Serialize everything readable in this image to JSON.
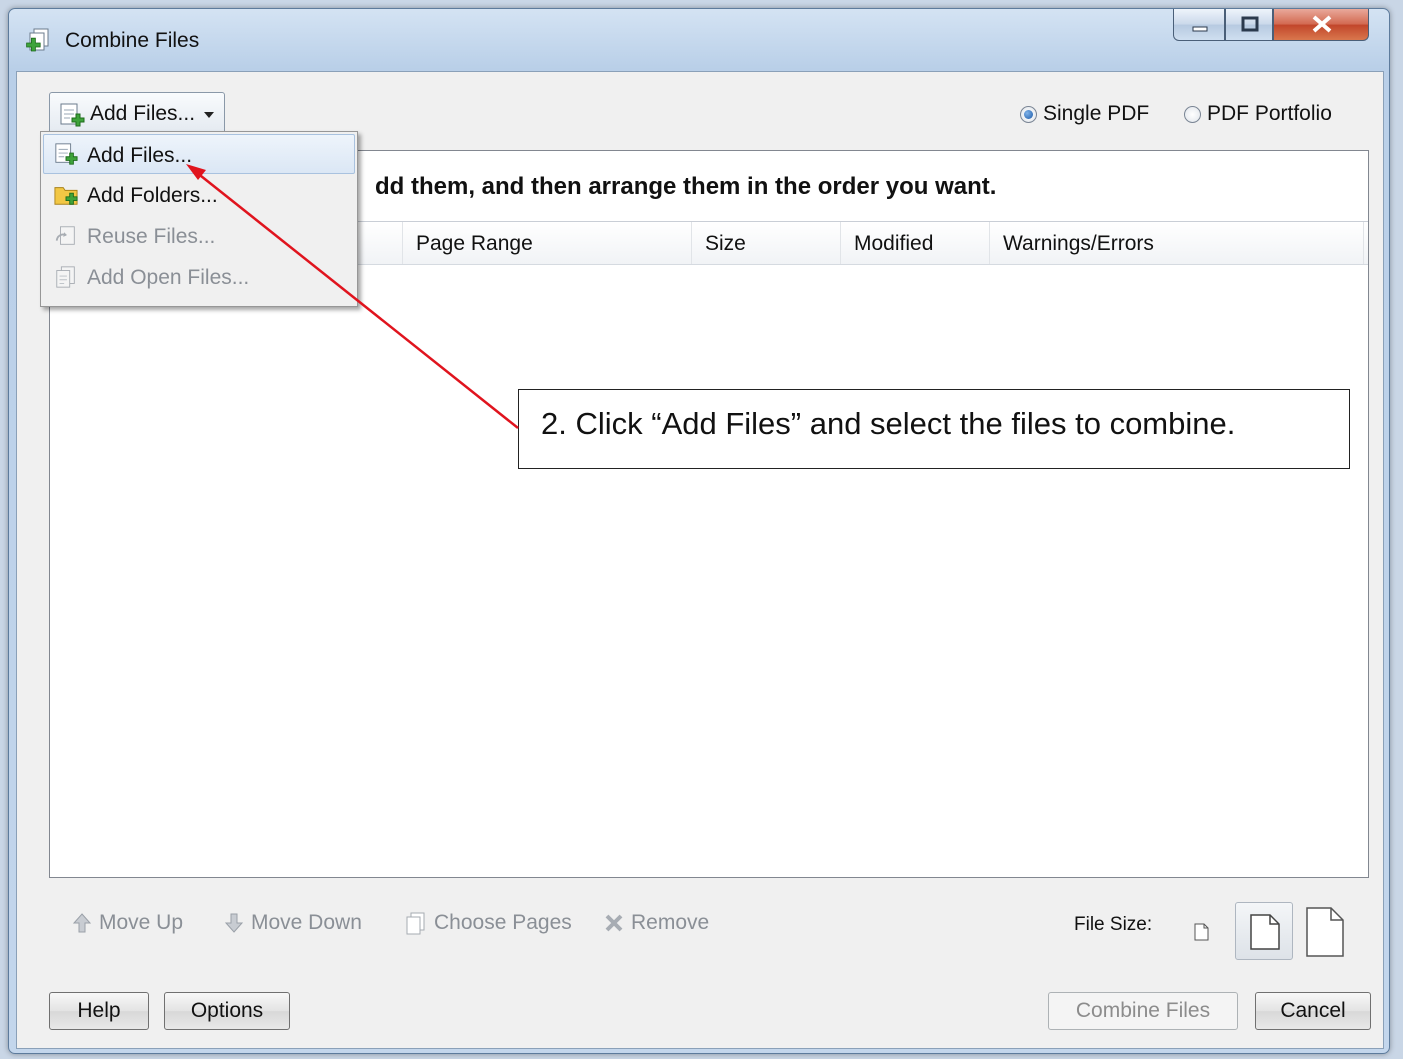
{
  "window": {
    "title": "Combine Files"
  },
  "toolbar": {
    "add_files_label": "Add Files...",
    "output_options": [
      {
        "label": "Single PDF",
        "selected": true
      },
      {
        "label": "PDF Portfolio",
        "selected": false
      }
    ]
  },
  "list": {
    "instruction": "dd them, and then arrange them in the order you want.",
    "columns": [
      "Page Range",
      "Size",
      "Modified",
      "Warnings/Errors"
    ]
  },
  "dropdown_menu": {
    "items": [
      {
        "label": "Add Files...",
        "enabled": true,
        "highlighted": true,
        "icon": "add-file-icon"
      },
      {
        "label": "Add Folders...",
        "enabled": true,
        "highlighted": false,
        "icon": "add-folder-icon"
      },
      {
        "label": "Reuse Files...",
        "enabled": false,
        "highlighted": false,
        "icon": "reuse-files-icon"
      },
      {
        "label": "Add Open Files...",
        "enabled": false,
        "highlighted": false,
        "icon": "add-open-files-icon"
      }
    ]
  },
  "bottom_toolbar": {
    "move_up": "Move Up",
    "move_down": "Move Down",
    "choose_pages": "Choose Pages",
    "remove": "Remove",
    "file_size_label": "File Size:"
  },
  "footer": {
    "help": "Help",
    "options": "Options",
    "combine_files": "Combine Files",
    "cancel": "Cancel"
  },
  "callout": {
    "text": "2.  Click “Add Files” and select the files to combine."
  },
  "colors": {
    "arrow": "#e0141e",
    "disabled_text": "#8a8f96",
    "close_button": "#c1452a"
  }
}
